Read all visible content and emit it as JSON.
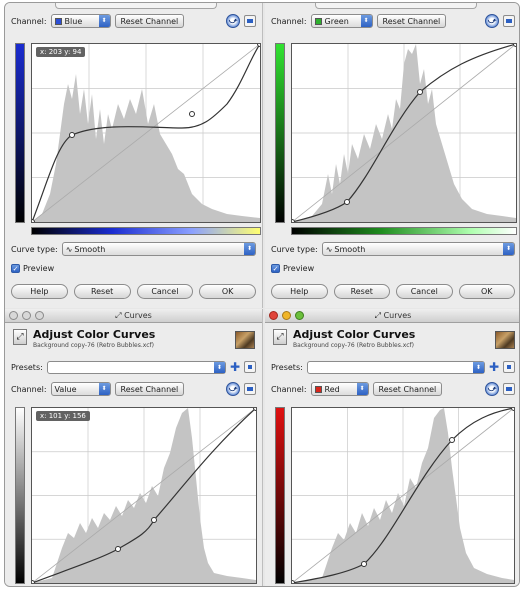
{
  "top_left": {
    "channel_label": "Channel:",
    "channel_value": "Blue",
    "channel_color": "#2c4fd6",
    "reset_label": "Reset Channel",
    "coord": "x: 203 y: 94",
    "curve_type_label": "Curve type:",
    "curve_type_value": "Smooth",
    "preview_label": "Preview",
    "help_label": "Help",
    "reset_button": "Reset",
    "cancel_label": "Cancel",
    "ok_label": "OK"
  },
  "top_right": {
    "channel_label": "Channel:",
    "channel_value": "Green",
    "channel_color": "#2fb12f",
    "reset_label": "Reset Channel",
    "curve_type_label": "Curve type:",
    "curve_type_value": "Smooth",
    "preview_label": "Preview",
    "help_label": "Help",
    "reset_button": "Reset",
    "cancel_label": "Cancel",
    "ok_label": "OK"
  },
  "bottom_left": {
    "window_title": "Curves",
    "dialog_title": "Adjust Color Curves",
    "subtitle": "Background copy-76 (Retro Bubbles.xcf)",
    "presets_label": "Presets:",
    "channel_label": "Channel:",
    "channel_value": "Value",
    "reset_label": "Reset Channel",
    "coord": "x: 101 y: 156"
  },
  "bottom_right": {
    "window_title": "Curves",
    "dialog_title": "Adjust Color Curves",
    "subtitle": "Background copy-76 (Retro Bubbles.xcf)",
    "presets_label": "Presets:",
    "channel_label": "Channel:",
    "channel_value": "Red",
    "channel_color": "#d9261c",
    "reset_label": "Reset Channel"
  },
  "colors": {
    "blue_grad": "#1a2cd0",
    "green_grad": "#31e331",
    "red_grad": "#e01010",
    "accent": "#2e62c4"
  }
}
